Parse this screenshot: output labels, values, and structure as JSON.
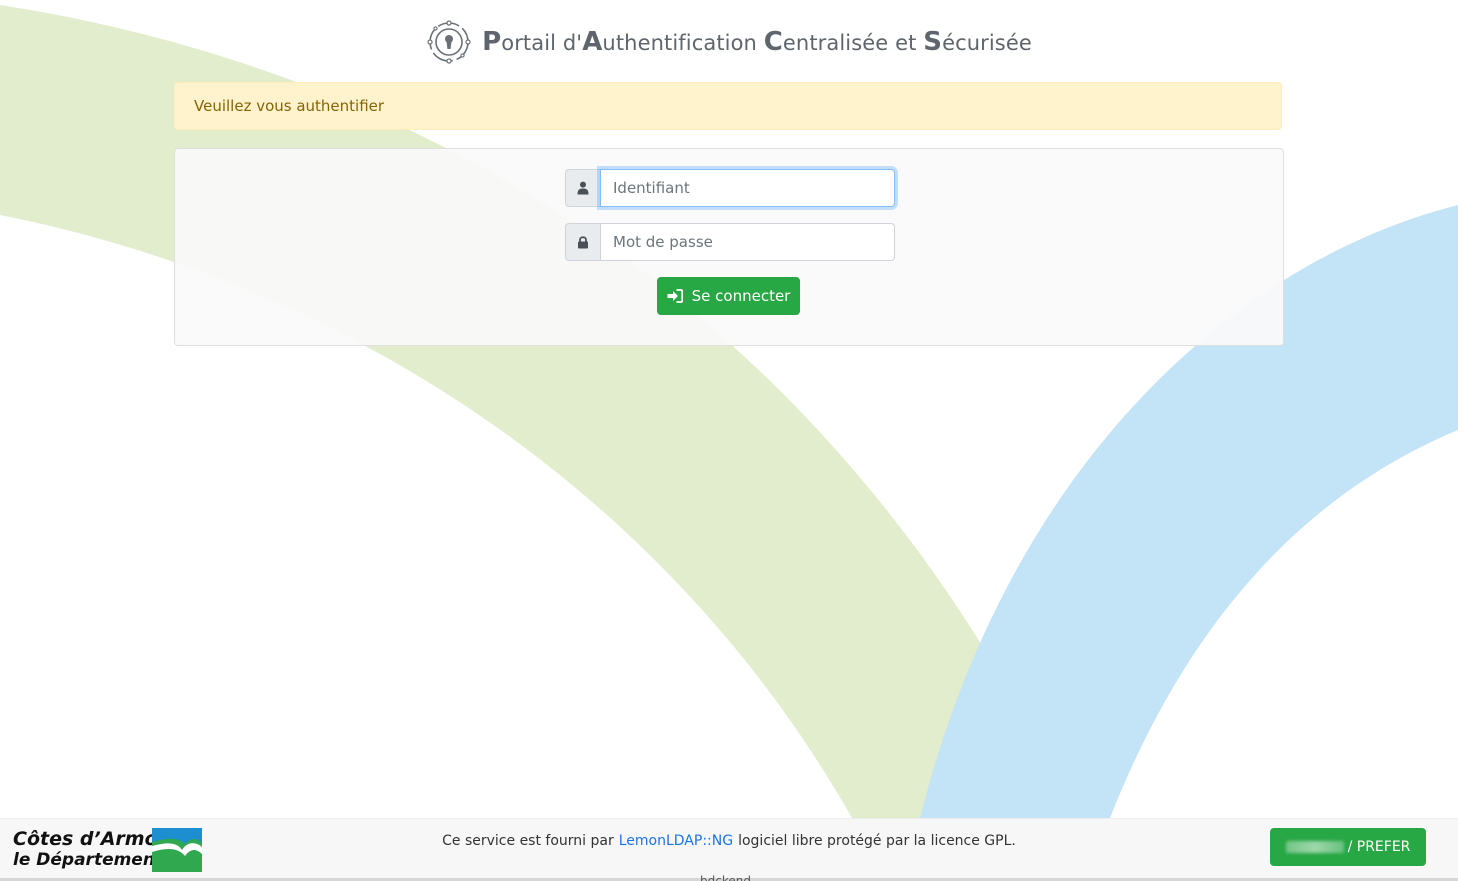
{
  "header": {
    "title_parts": [
      {
        "cap": "P",
        "rest": "ortail d'"
      },
      {
        "cap": "A",
        "rest": "uthentification "
      },
      {
        "cap": "C",
        "rest": "entralisée et "
      },
      {
        "cap": "S",
        "rest": "écurisée"
      }
    ],
    "logo_icon": "keyhole-network-icon"
  },
  "alert": {
    "message": "Veuillez vous authentifier"
  },
  "login_form": {
    "username_placeholder": "Identifiant",
    "username_value": "",
    "username_icon": "user-icon",
    "password_placeholder": "Mot de passe",
    "password_value": "",
    "password_icon": "lock-icon",
    "submit_label": "Se connecter",
    "submit_icon": "sign-in-icon"
  },
  "footer": {
    "org_line1": "Côtes d’Armor",
    "org_line2": "le Département",
    "text_before": "Ce service est fourni par",
    "link_text": "LemonLDAP::NG",
    "text_after": "logiciel libre protégé par la licence GPL.",
    "user_button_label": "/ PREFER",
    "cut_text": "bdckend"
  },
  "colors": {
    "alert_bg": "#fff3cd",
    "alert_text": "#856404",
    "primary_button": "#28a745",
    "link": "#1a73e8",
    "bg_green_arc": "#e1edcd",
    "bg_blue_arc": "#c3e3f6"
  }
}
